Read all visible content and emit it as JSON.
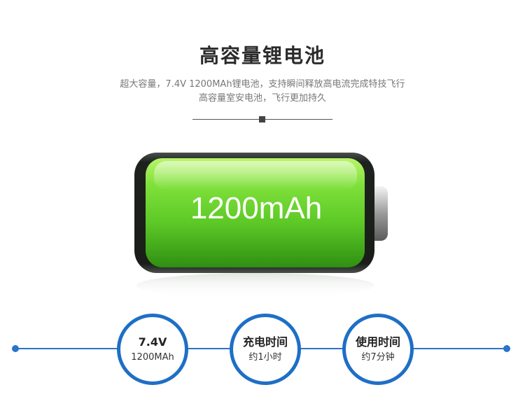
{
  "header": {
    "title": "高容量锂电池",
    "subtitle_line1": "超大容量，7.4V 1200MAh锂电池，支持瞬间释放高电流完成特技飞行",
    "subtitle_line2": "高容量室安电池，飞行更加持久"
  },
  "battery": {
    "capacity_label": "1200mAh",
    "fill_color": "#5fd02c"
  },
  "specs": [
    {
      "title": "7.4V",
      "detail": "1200MAh"
    },
    {
      "title": "充电时间",
      "detail": "约1小时"
    },
    {
      "title": "使用时间",
      "detail": "约7分钟"
    }
  ],
  "colors": {
    "accent": "#1e6fc6",
    "title_text": "#2b2b2b"
  }
}
